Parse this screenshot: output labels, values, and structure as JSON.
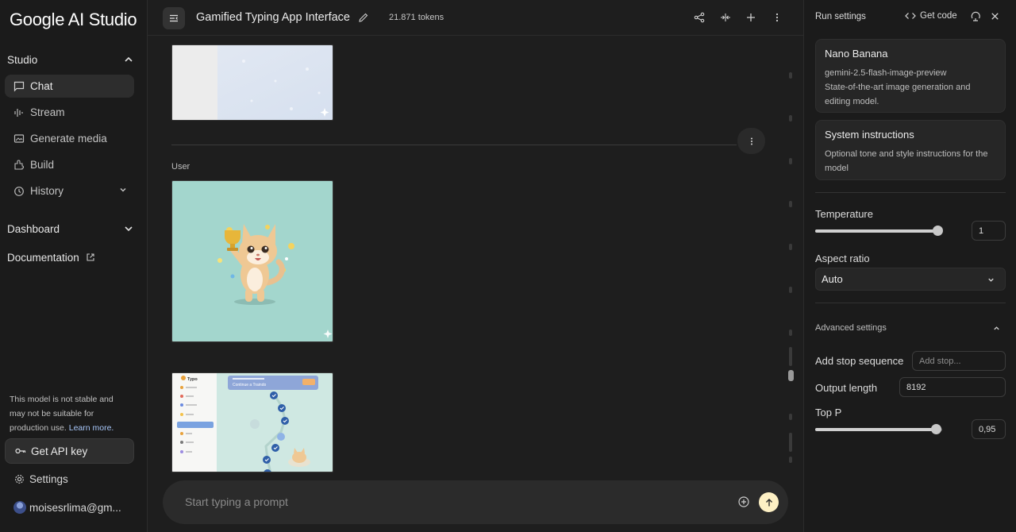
{
  "sidebar": {
    "logo": "Google AI Studio",
    "studio_label": "Studio",
    "items": [
      {
        "label": "Chat",
        "icon": "chat-icon"
      },
      {
        "label": "Stream",
        "icon": "stream-icon"
      },
      {
        "label": "Generate media",
        "icon": "media-icon"
      },
      {
        "label": "Build",
        "icon": "build-icon"
      },
      {
        "label": "History",
        "icon": "history-icon"
      }
    ],
    "dashboard_label": "Dashboard",
    "documentation_label": "Documentation",
    "notice_text": "This model is not stable and may not be suitable for production use.",
    "learn_more": "Learn more.",
    "api_key_label": "Get API key",
    "settings_label": "Settings",
    "account": "moisesrlima@gm..."
  },
  "header": {
    "title": "Gamified Typing App Interface",
    "tokens": "21.871 tokens"
  },
  "chat": {
    "user_label": "User",
    "mock_app_name": "Typo",
    "mock_header": "Continue a Traindo",
    "prompt_placeholder": "Start typing a prompt"
  },
  "panel": {
    "run_settings": "Run settings",
    "get_code": "Get code",
    "model": {
      "name": "Nano Banana",
      "id": "gemini-2.5-flash-image-preview",
      "description": "State-of-the-art image generation and editing model."
    },
    "system_instructions": {
      "title": "System instructions",
      "description": "Optional tone and style instructions for the model"
    },
    "temperature": {
      "label": "Temperature",
      "value": "1",
      "fraction": 0.96
    },
    "aspect_ratio": {
      "label": "Aspect ratio",
      "value": "Auto"
    },
    "advanced_label": "Advanced settings",
    "stop_sequence": {
      "label": "Add stop sequence",
      "placeholder": "Add stop..."
    },
    "output_length": {
      "label": "Output length",
      "value": "8192"
    },
    "top_p": {
      "label": "Top P",
      "value": "0,95",
      "fraction": 0.95
    }
  },
  "colors": {
    "background": "#1e1e1e",
    "accent_send": "#fdf0c4",
    "link": "#a8c7fa",
    "image_teal": "#a3d6cd"
  }
}
